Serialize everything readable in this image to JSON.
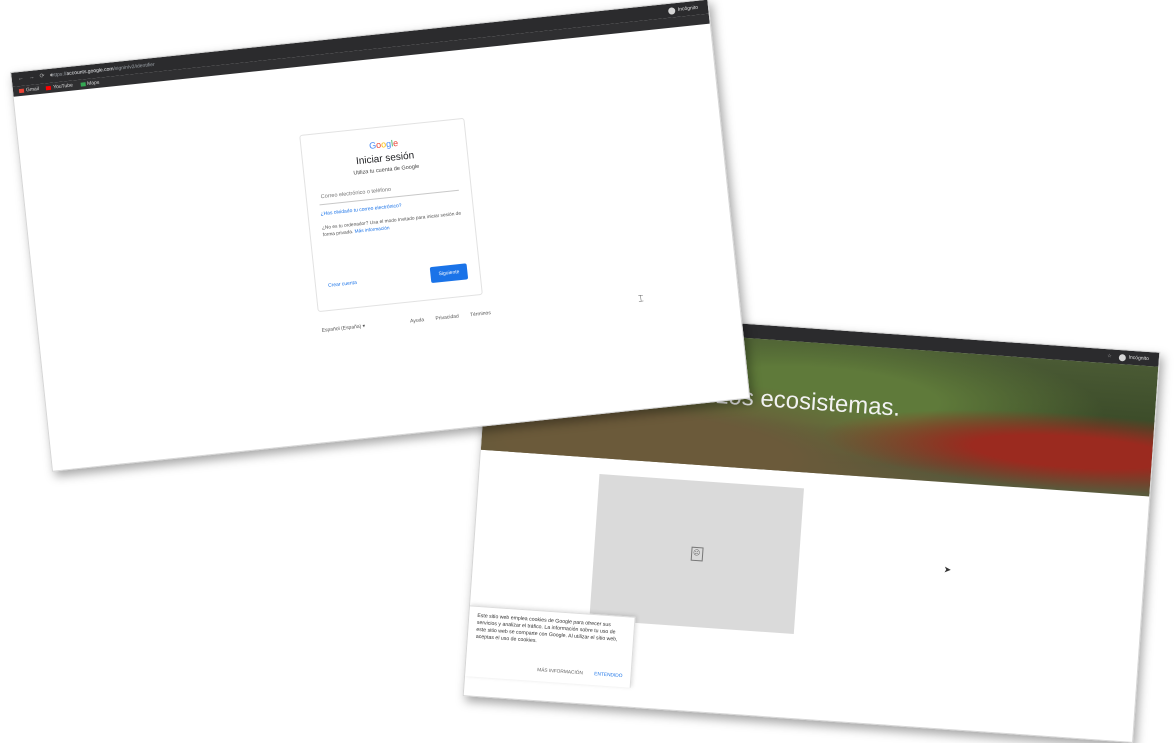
{
  "login_window": {
    "url_prefix": "https://",
    "url_domain": "accounts.google.com",
    "url_rest": "/signin/v2/identifier",
    "profile_label": "Incógnito",
    "bookmarks": [
      "Gmail",
      "YouTube",
      "Maps"
    ],
    "bookmark_colors": [
      "#ea4335",
      "#ff0000",
      "#34a853"
    ],
    "logo_letters": [
      "G",
      "o",
      "o",
      "g",
      "l",
      "e"
    ],
    "title": "Iniciar sesión",
    "subtitle": "Utiliza tu cuenta de Google",
    "email_placeholder": "Correo electrónico o teléfono",
    "forgot_email": "¿Has olvidado tu correo electrónico?",
    "guest_text": "¿No es tu ordenador? Usa el modo Invitado para iniciar sesión de forma privada.",
    "guest_link": "Más información",
    "create_account": "Crear cuenta",
    "next_button": "Siguiente",
    "language": "Español (España)",
    "footer_links": [
      "Ayuda",
      "Privacidad",
      "Términos"
    ]
  },
  "site_window": {
    "profile_label": "Incógnito",
    "hero_text": "Los ecosistemas.",
    "cookie_text": "Este sitio web emplea cookies de Google para ofrecer sus servicios y analizar el tráfico. La información sobre tu uso de este sitio web se comparte con Google. Al utilizar el sitio web, aceptas el uso de cookies.",
    "more_info": "MÁS INFORMACIÓN",
    "ok": "ENTENDIDO"
  }
}
